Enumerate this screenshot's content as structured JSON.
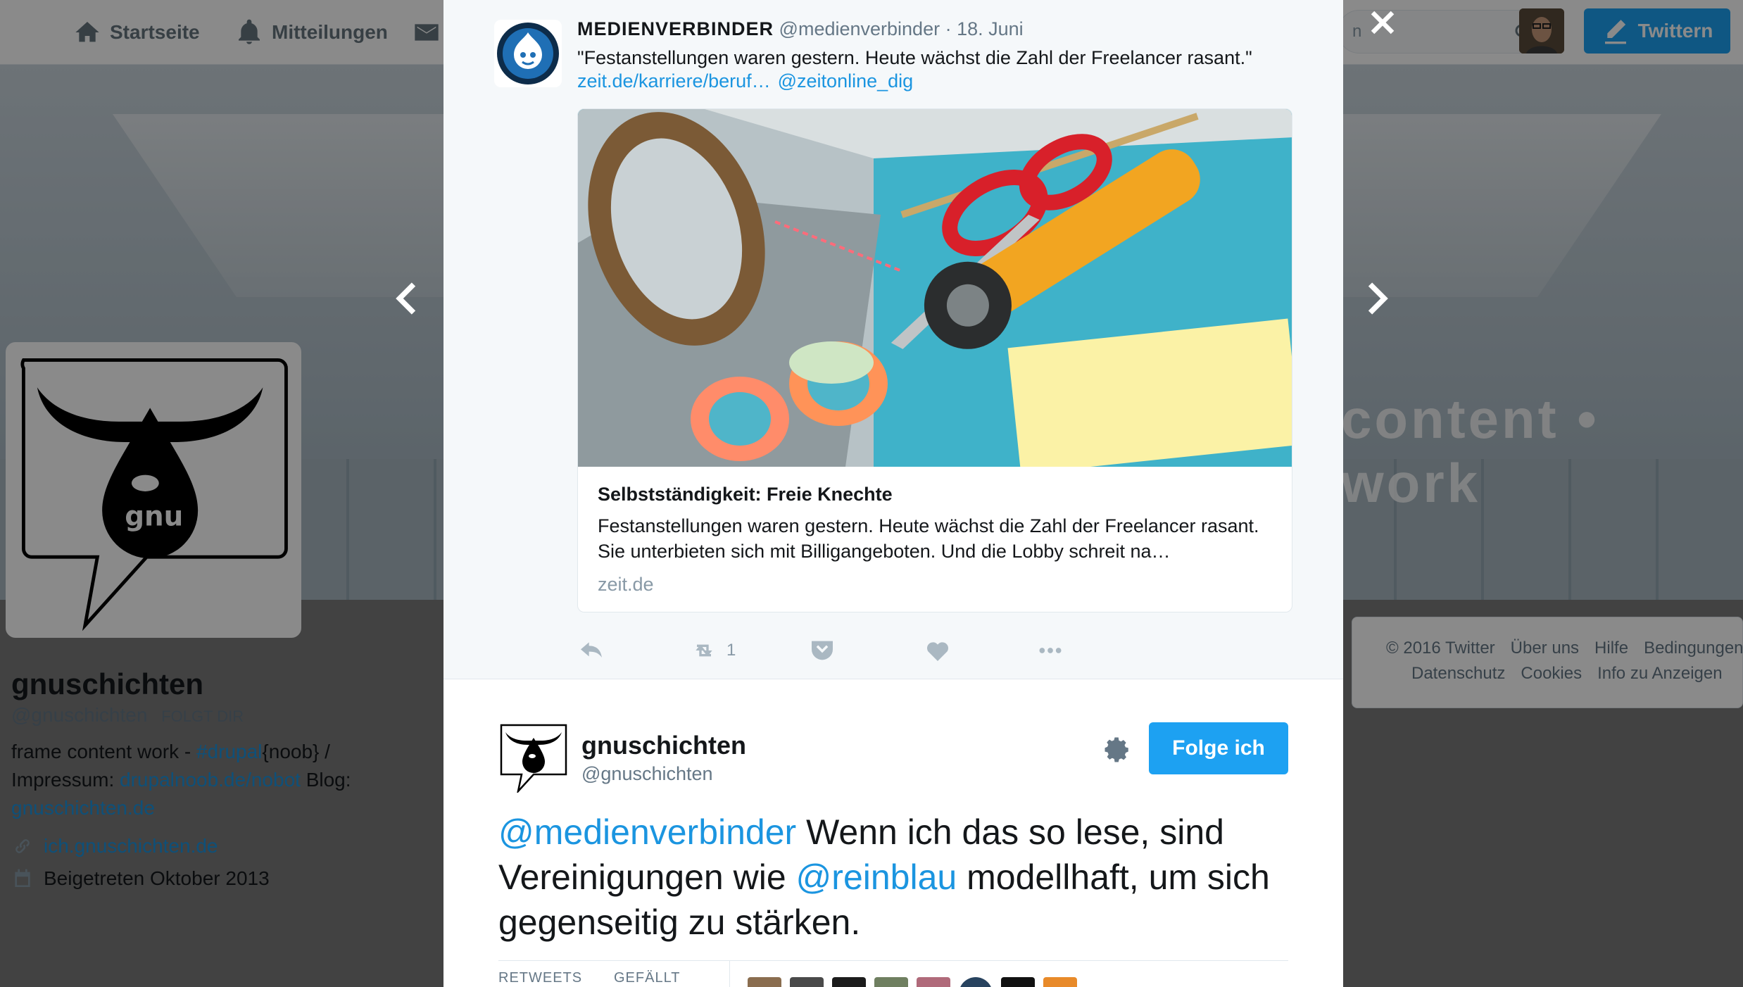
{
  "topnav": {
    "items": [
      {
        "label": "Startseite",
        "icon": "home-icon"
      },
      {
        "label": "Mitteilungen",
        "icon": "bell-icon"
      }
    ],
    "messages_icon": "envelope-icon",
    "search_placeholder": "n",
    "tweet_button_label": "Twittern"
  },
  "banner": {
    "text": "content • work"
  },
  "profile": {
    "name": "gnuschichten",
    "handle": "@gnuschichten",
    "follows_you": "FOLGT DIR",
    "bio": {
      "line1_pre": "frame content work - ",
      "line1_link": "#drupal",
      "line1_post": "{noob} /",
      "line2_pre": "Impressum: ",
      "line2_link": "drupalnoob.de/nobot",
      "line2_post": " Blog:",
      "line3_link": "gnuschichten.de"
    },
    "website": "ich.gnuschichten.de",
    "joined": "Beigetreten Oktober 2013"
  },
  "footer": {
    "row1": [
      "© 2016 Twitter",
      "Über uns",
      "Hilfe",
      "Bedingungen"
    ],
    "row2": [
      "Datenschutz",
      "Cookies",
      "Info zu Anzeigen"
    ]
  },
  "parent_tweet": {
    "name": "MEDIENVERBINDER",
    "handle": "@medienverbinder",
    "separator": "·",
    "date": "18. Juni",
    "text": "\"Festanstellungen waren gestern. Heute wächst die Zahl der Freelancer rasant.\"",
    "link1": "zeit.de/karriere/beruf…",
    "link2": "@zeitonline_dig",
    "card": {
      "title": "Selbstständigkeit: Freie Knechte",
      "description": "Festanstellungen waren gestern. Heute wächst die Zahl der Freelancer rasant. Sie unterbieten sich mit Billigangeboten. Und die Lobby schreit na…",
      "domain": "zeit.de"
    },
    "retweet_count": "1"
  },
  "reply_tweet": {
    "name": "gnuschichten",
    "handle": "@gnuschichten",
    "follow_label": "Folge ich",
    "text_mention1": "@medienverbinder",
    "text_part1": " Wenn ich das so lese, sind Vereinigungen wie ",
    "text_mention2": "@reinblau",
    "text_part2": " modellhaft, um sich gegenseitig zu stärken.",
    "stat_retweets": "RETWEETS",
    "stat_likes": "GEFÄLLT"
  },
  "colors": {
    "accent": "#1da1f2",
    "link": "#1b95e0",
    "muted": "#657786"
  }
}
